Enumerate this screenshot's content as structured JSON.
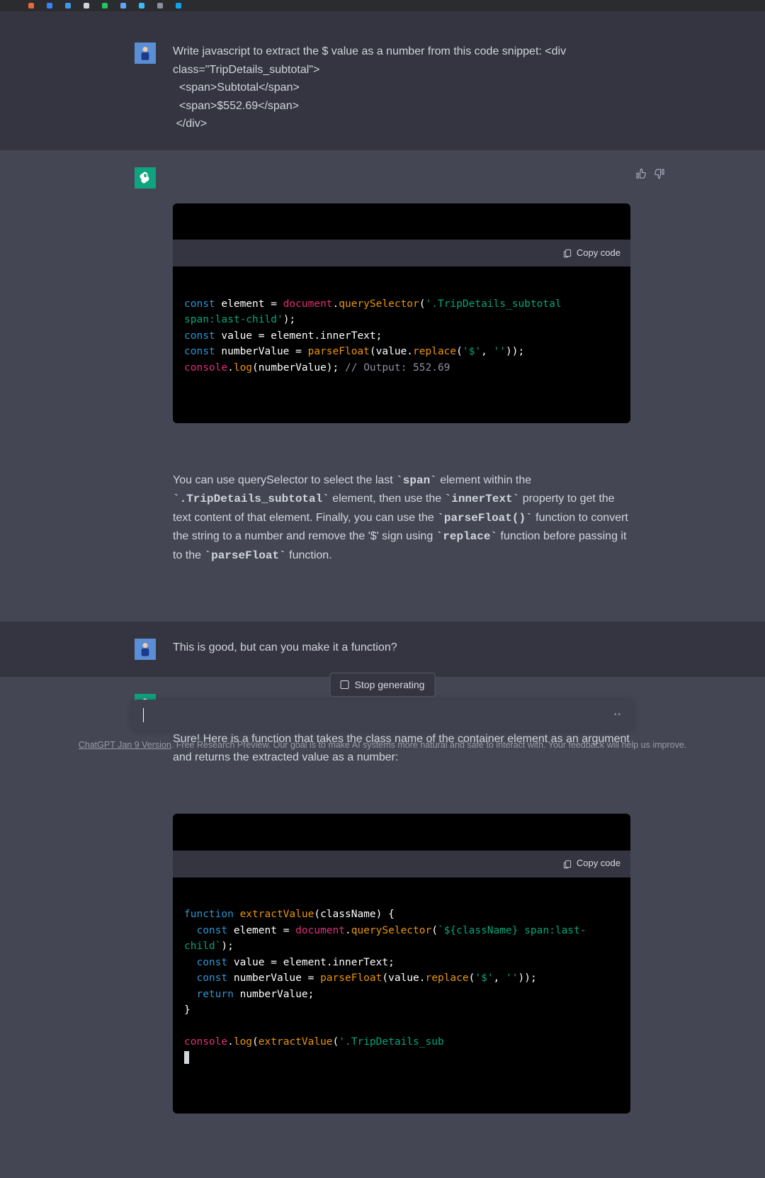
{
  "messages": {
    "user1": "Write javascript to extract the $ value as a number from this code snippet: <div class=\"TripDetails_subtotal\">\n  <span>Subtotal</span>\n  <span>$552.69</span>\n </div>",
    "assistant1_explain_pre": "You can use querySelector to select the last ",
    "assistant1_code_span": "`span`",
    "assistant1_t2": " element within the ",
    "assistant1_code_class": "`.TripDetails_subtotal`",
    "assistant1_t3": " element, then use the ",
    "assistant1_code_inner": "`innerText`",
    "assistant1_t4": " property to get the text content of that element. Finally, you can use the ",
    "assistant1_code_pf": "`parseFloat()`",
    "assistant1_t5": " function to convert the string to a number and remove the '$' sign using ",
    "assistant1_code_rep": "`replace`",
    "assistant1_t6": " function before passing it to the ",
    "assistant1_code_pf2": "`parseFloat`",
    "assistant1_t7": " function.",
    "user2": "This is good, but can you make it a function?",
    "assistant2_intro": "Sure! Here is a function that takes the class name of the container element as an argument and returns the extracted value as a number:"
  },
  "code1": {
    "l1_kw": "const",
    "l1_a": " element = ",
    "l1_obj": "document",
    "l1_d": ".",
    "l1_fn": "querySelector",
    "l1_p": "(",
    "l1_str": "'.TripDetails_subtotal span:last-child'",
    "l1_e": ");",
    "l2_kw": "const",
    "l2_a": " value = element.innerText;",
    "l3_kw": "const",
    "l3_a": " numberValue = ",
    "l3_fn": "parseFloat",
    "l3_b": "(value.",
    "l3_fn2": "replace",
    "l3_c": "(",
    "l3_str1": "'$'",
    "l3_d": ", ",
    "l3_str2": "''",
    "l3_e": "));",
    "l4_obj": "console",
    "l4_d": ".",
    "l4_fn": "log",
    "l4_a": "(numberValue); ",
    "l4_cm": "// Output: 552.69"
  },
  "code2": {
    "l1_kw": "function",
    "l1_sp": " ",
    "l1_fn": "extractValue",
    "l1_a": "(className) {",
    "l2_kw": "const",
    "l2_a": " element = ",
    "l2_obj": "document",
    "l2_d": ".",
    "l2_fn": "querySelector",
    "l2_p": "(",
    "l2_str": "`${className} span:last-child`",
    "l2_e": ");",
    "l3_kw": "const",
    "l3_a": " value = element.innerText;",
    "l4_kw": "const",
    "l4_a": " numberValue = ",
    "l4_fn": "parseFloat",
    "l4_b": "(value.",
    "l4_fn2": "replace",
    "l4_c": "(",
    "l4_str1": "'$'",
    "l4_d": ", ",
    "l4_str2": "''",
    "l4_e": "));",
    "l5_kw": "return",
    "l5_a": " numberValue;",
    "l6": "}",
    "l7_obj": "console",
    "l7_d": ".",
    "l7_fn": "log",
    "l7_a": "(",
    "l7_fn2": "extractValue",
    "l7_b": "(",
    "l7_str": "'.TripDetails_sub"
  },
  "ui": {
    "copy_code": "Copy code",
    "stop_generating": "Stop generating",
    "footer_link": "ChatGPT Jan 9 Version",
    "footer_text": ". Free Research Preview. Our goal is to make AI systems more natural and safe to interact with. Your feedback will help us improve.",
    "input_placeholder": ""
  }
}
